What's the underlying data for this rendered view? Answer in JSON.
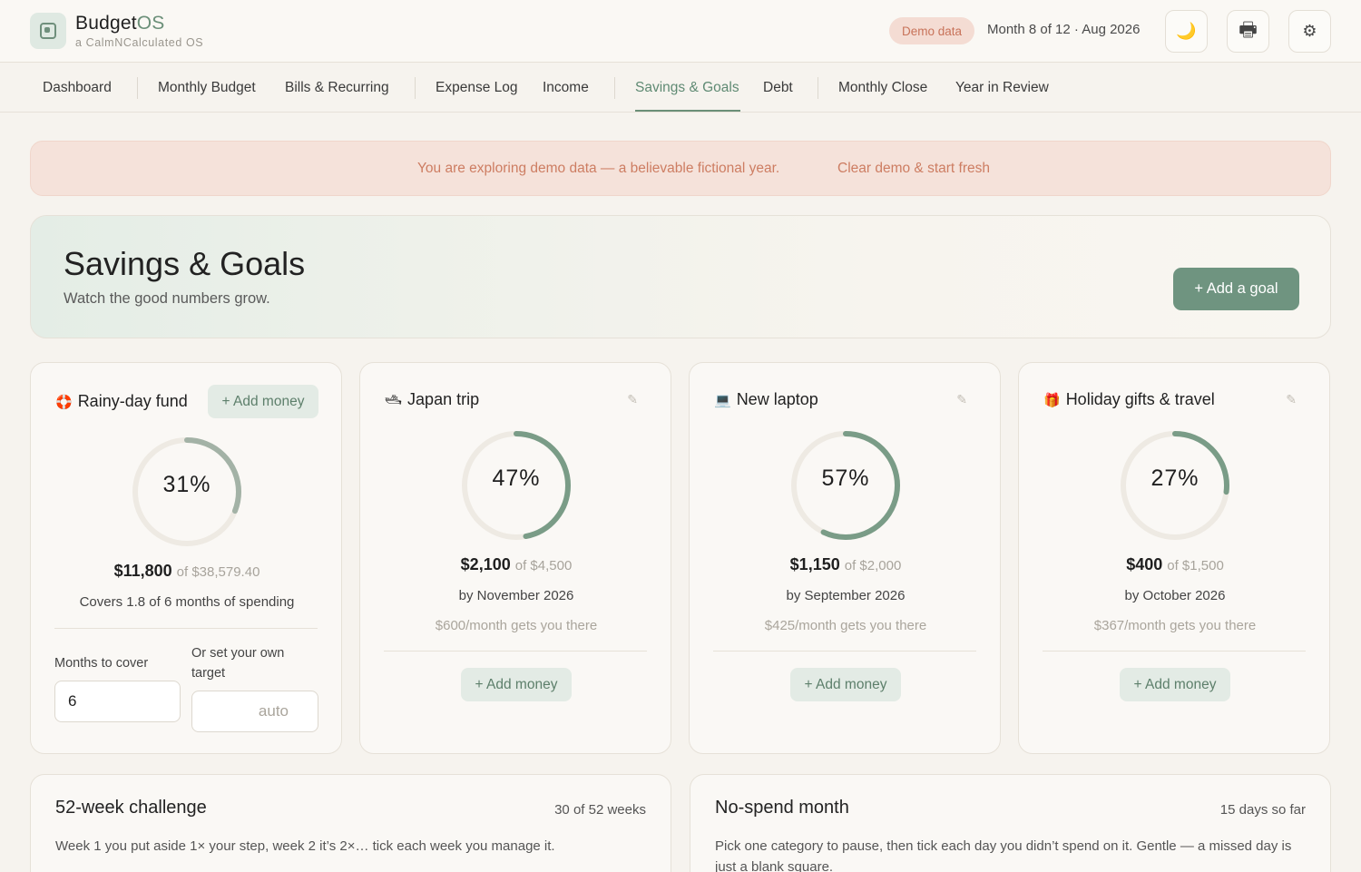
{
  "app": {
    "brand_main": "Budget",
    "brand_accent": "OS",
    "tagline": "a CalmNCalculated OS",
    "demo_pill": "Demo data",
    "month_text": "Month 8 of 12 · Aug 2026",
    "icons": [
      "moon-icon",
      "printer-icon",
      "gear-icon"
    ],
    "theme_glyph": "🌙",
    "print_glyph": "🖶",
    "settings_glyph": "⚙"
  },
  "nav": {
    "items": [
      "Dashboard",
      "Monthly Budget",
      "Bills & Recurring",
      "Expense Log",
      "Income",
      "Savings & Goals",
      "Debt",
      "Monthly Close",
      "Year in Review"
    ],
    "active": "Savings & Goals"
  },
  "banner": {
    "text": "You are exploring demo data — a believable fictional year.",
    "link": "Clear demo & start fresh"
  },
  "hero": {
    "title": "Savings & Goals",
    "subtitle": "Watch the good numbers grow.",
    "add_goal": "+ Add a goal"
  },
  "emergency": {
    "emoji": "🛟",
    "title": "Rainy-day fund",
    "add_money": "+ Add money",
    "percent": 31,
    "percent_label": "31%",
    "amount": "$11,800",
    "of_text": "of $38,579.40",
    "covers": "Covers 1.8 of 6 months of spending",
    "months_label": "Months to cover",
    "months_value": "6",
    "target_label": "Or set your own target",
    "target_placeholder": "auto"
  },
  "goals": [
    {
      "emoji": "🛥",
      "title": "Japan trip",
      "percent": 47,
      "percent_label": "47%",
      "amount": "$2,100",
      "of_text": "of $4,500",
      "by": "by November 2026",
      "hint": "$600/month gets you there",
      "add_money": "+ Add money"
    },
    {
      "emoji": "💻",
      "title": "New laptop",
      "percent": 57,
      "percent_label": "57%",
      "amount": "$1,150",
      "of_text": "of $2,000",
      "by": "by September 2026",
      "hint": "$425/month gets you there",
      "add_money": "+ Add money"
    },
    {
      "emoji": "🎁",
      "title": "Holiday gifts & travel",
      "percent": 27,
      "percent_label": "27%",
      "amount": "$400",
      "of_text": "of $1,500",
      "by": "by October 2026",
      "hint": "$367/month gets you there",
      "add_money": "+ Add money"
    }
  ],
  "edit_glyph": "✎",
  "challenge": {
    "title": "52-week challenge",
    "meta": "30 of 52 weeks",
    "text": "Week 1 you put aside 1× your step, week 2 it’s 2×… tick each week you manage it."
  },
  "nospend": {
    "title": "No-spend month",
    "meta": "15 days so far",
    "text": "Pick one category to pause, then tick each day you didn’t spend on it. Gentle — a missed day is just a blank square."
  },
  "colors": {
    "accent": "#6f9480",
    "ring_track": "#eeeae3",
    "ring_fill": "#7a9c87",
    "ring_fill_muted": "#a3b2a6",
    "demo": "#cd7d62"
  }
}
